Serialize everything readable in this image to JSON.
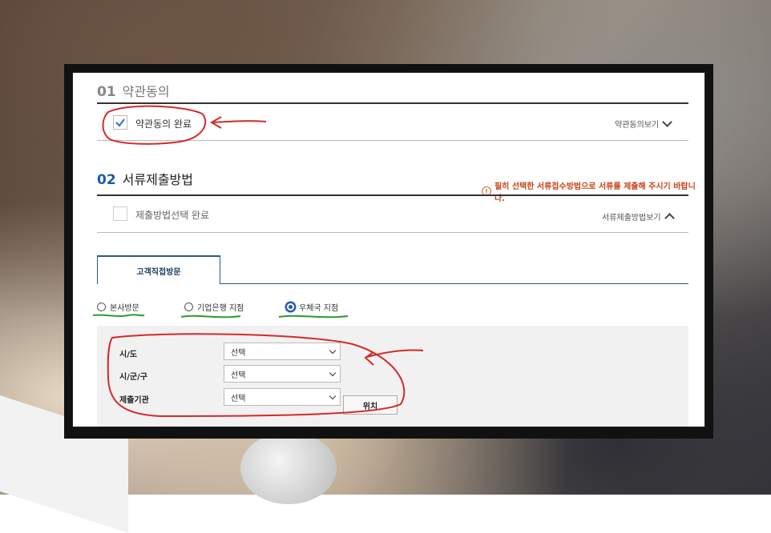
{
  "section1": {
    "number": "01",
    "title": "약관동의",
    "checkbox_label": "약관동의 완료",
    "view_link": "약관동의보기"
  },
  "section2": {
    "number": "02",
    "title": "서류제출방법",
    "warning": "필히 선택한 서류접수방법으로 서류를 제출해 주시기 바랍니다.",
    "checkbox_label": "제출방법선택 완료",
    "view_link": "서류제출방법보기"
  },
  "tabs": [
    {
      "label": "고객직접방문"
    }
  ],
  "radios": [
    {
      "label": "본사방문",
      "checked": false
    },
    {
      "label": "기업은행 지점",
      "checked": false
    },
    {
      "label": "우체국 지점",
      "checked": true
    }
  ],
  "form": {
    "fields": [
      {
        "label": "시/도",
        "value": "선택"
      },
      {
        "label": "시/군/구",
        "value": "선택"
      },
      {
        "label": "제출기관",
        "value": "선택"
      }
    ],
    "location_button": "위치"
  },
  "colors": {
    "accent_blue": "#1e5aa8",
    "warning_orange": "#c8441b",
    "annotation_red": "#d42a2a",
    "annotation_green": "#2e9a2e"
  }
}
